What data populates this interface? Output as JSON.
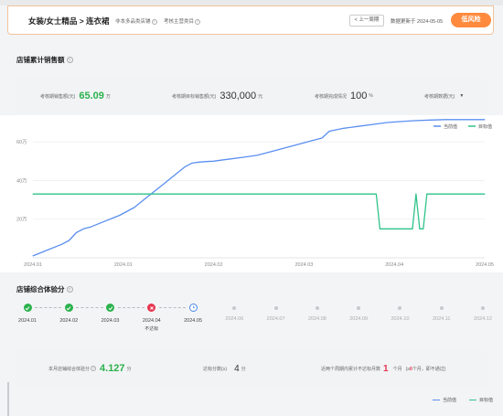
{
  "header": {
    "title": "女装/女士精品 > 连衣裙",
    "link1": "非本多品类店铺",
    "link2": "考核主营类目",
    "prev_label": "< 上一周期",
    "updated": "数据更新于 2024-05-05",
    "risk_label": "低风险"
  },
  "sales_section": {
    "title": "店铺累计销售额",
    "metrics": [
      {
        "label": "考核期销售额(元)",
        "value": "65.09",
        "unit": "万"
      },
      {
        "label": "考核期目标销售额(元)",
        "value": "330,000",
        "unit": "元"
      },
      {
        "label": "考核期完成情况",
        "value": "100",
        "unit": "%"
      },
      {
        "label": "考核期数据(元)",
        "value": "",
        "unit": ""
      }
    ]
  },
  "score_section": {
    "title": "店铺综合体验分",
    "timeline": [
      {
        "date": "2024.01",
        "status": "done",
        "sub": ""
      },
      {
        "date": "2024.02",
        "status": "done",
        "sub": ""
      },
      {
        "date": "2024.03",
        "status": "done",
        "sub": ""
      },
      {
        "date": "2024.04",
        "status": "fail",
        "sub": "不达标"
      },
      {
        "date": "2024.05",
        "status": "current",
        "sub": ""
      },
      {
        "date": "2024.06",
        "status": "future",
        "sub": ""
      },
      {
        "date": "2024.07",
        "status": "future",
        "sub": ""
      },
      {
        "date": "2024.08",
        "status": "future",
        "sub": ""
      },
      {
        "date": "2024.09",
        "status": "future",
        "sub": ""
      },
      {
        "date": "2024.10",
        "status": "future",
        "sub": ""
      },
      {
        "date": "2024.11",
        "status": "future",
        "sub": ""
      },
      {
        "date": "2024.12",
        "status": "future",
        "sub": ""
      }
    ],
    "metrics": {
      "score_label": "本月店铺综合体验分",
      "score_value": "4.127",
      "score_unit": "分",
      "std_label": "达标分数(≥)",
      "std_value": "4",
      "std_unit": "分",
      "months_label": "近两个周期内累计不达标月数",
      "months_value": "1",
      "months_unit": "个月",
      "months_note_pre": "(≥",
      "months_note_num": "6",
      "months_note_post": "个月，即不通过)"
    }
  },
  "legend2": {
    "current": "当前值",
    "target": "目标值"
  },
  "colors": {
    "current": "#5b8ff0",
    "target": "#2fc38a",
    "ok": "#2bb24c",
    "bad": "#e8344e",
    "accent": "#ff8a3d"
  },
  "chart_data": {
    "type": "line",
    "title": "",
    "xlabel": "",
    "ylabel": "",
    "ylim": [
      0,
      70
    ],
    "yticks": [
      20,
      40,
      60
    ],
    "ytick_labels": [
      "20万",
      "40万",
      "60万"
    ],
    "x_tick_labels": [
      "2024.01",
      "2024.01",
      "2024.02",
      "2024.03",
      "2024.04",
      "2024.05"
    ],
    "x_range_days": 125,
    "grid": true,
    "legend_position": "top-right",
    "series": [
      {
        "name": "当前值",
        "color": "#5b8ff0",
        "x": [
          0,
          4,
          8,
          10,
          12,
          14,
          16,
          20,
          24,
          28,
          32,
          36,
          40,
          42,
          44,
          46,
          48,
          50,
          52,
          54,
          58,
          62,
          66,
          70,
          74,
          76,
          78,
          80,
          82,
          86,
          90,
          94,
          98,
          102,
          106,
          110,
          114,
          118,
          122,
          125
        ],
        "y": [
          1,
          4,
          7,
          9,
          13,
          15,
          16,
          19,
          22,
          26,
          32,
          38,
          44,
          47,
          49,
          49.5,
          49.8,
          50,
          50.5,
          51,
          52,
          53,
          55,
          57,
          59,
          60,
          61,
          62,
          65.5,
          67,
          68,
          69,
          70,
          70.5,
          71,
          71.3,
          71.5,
          71.5,
          71.5,
          71.5
        ]
      },
      {
        "name": "目标值",
        "color": "#2fc38a",
        "x": [
          0,
          95,
          96,
          105,
          106,
          107,
          108,
          109,
          110,
          111,
          125
        ],
        "y": [
          33,
          33,
          15,
          15,
          33,
          15,
          15,
          33,
          33,
          33,
          33
        ]
      }
    ]
  }
}
